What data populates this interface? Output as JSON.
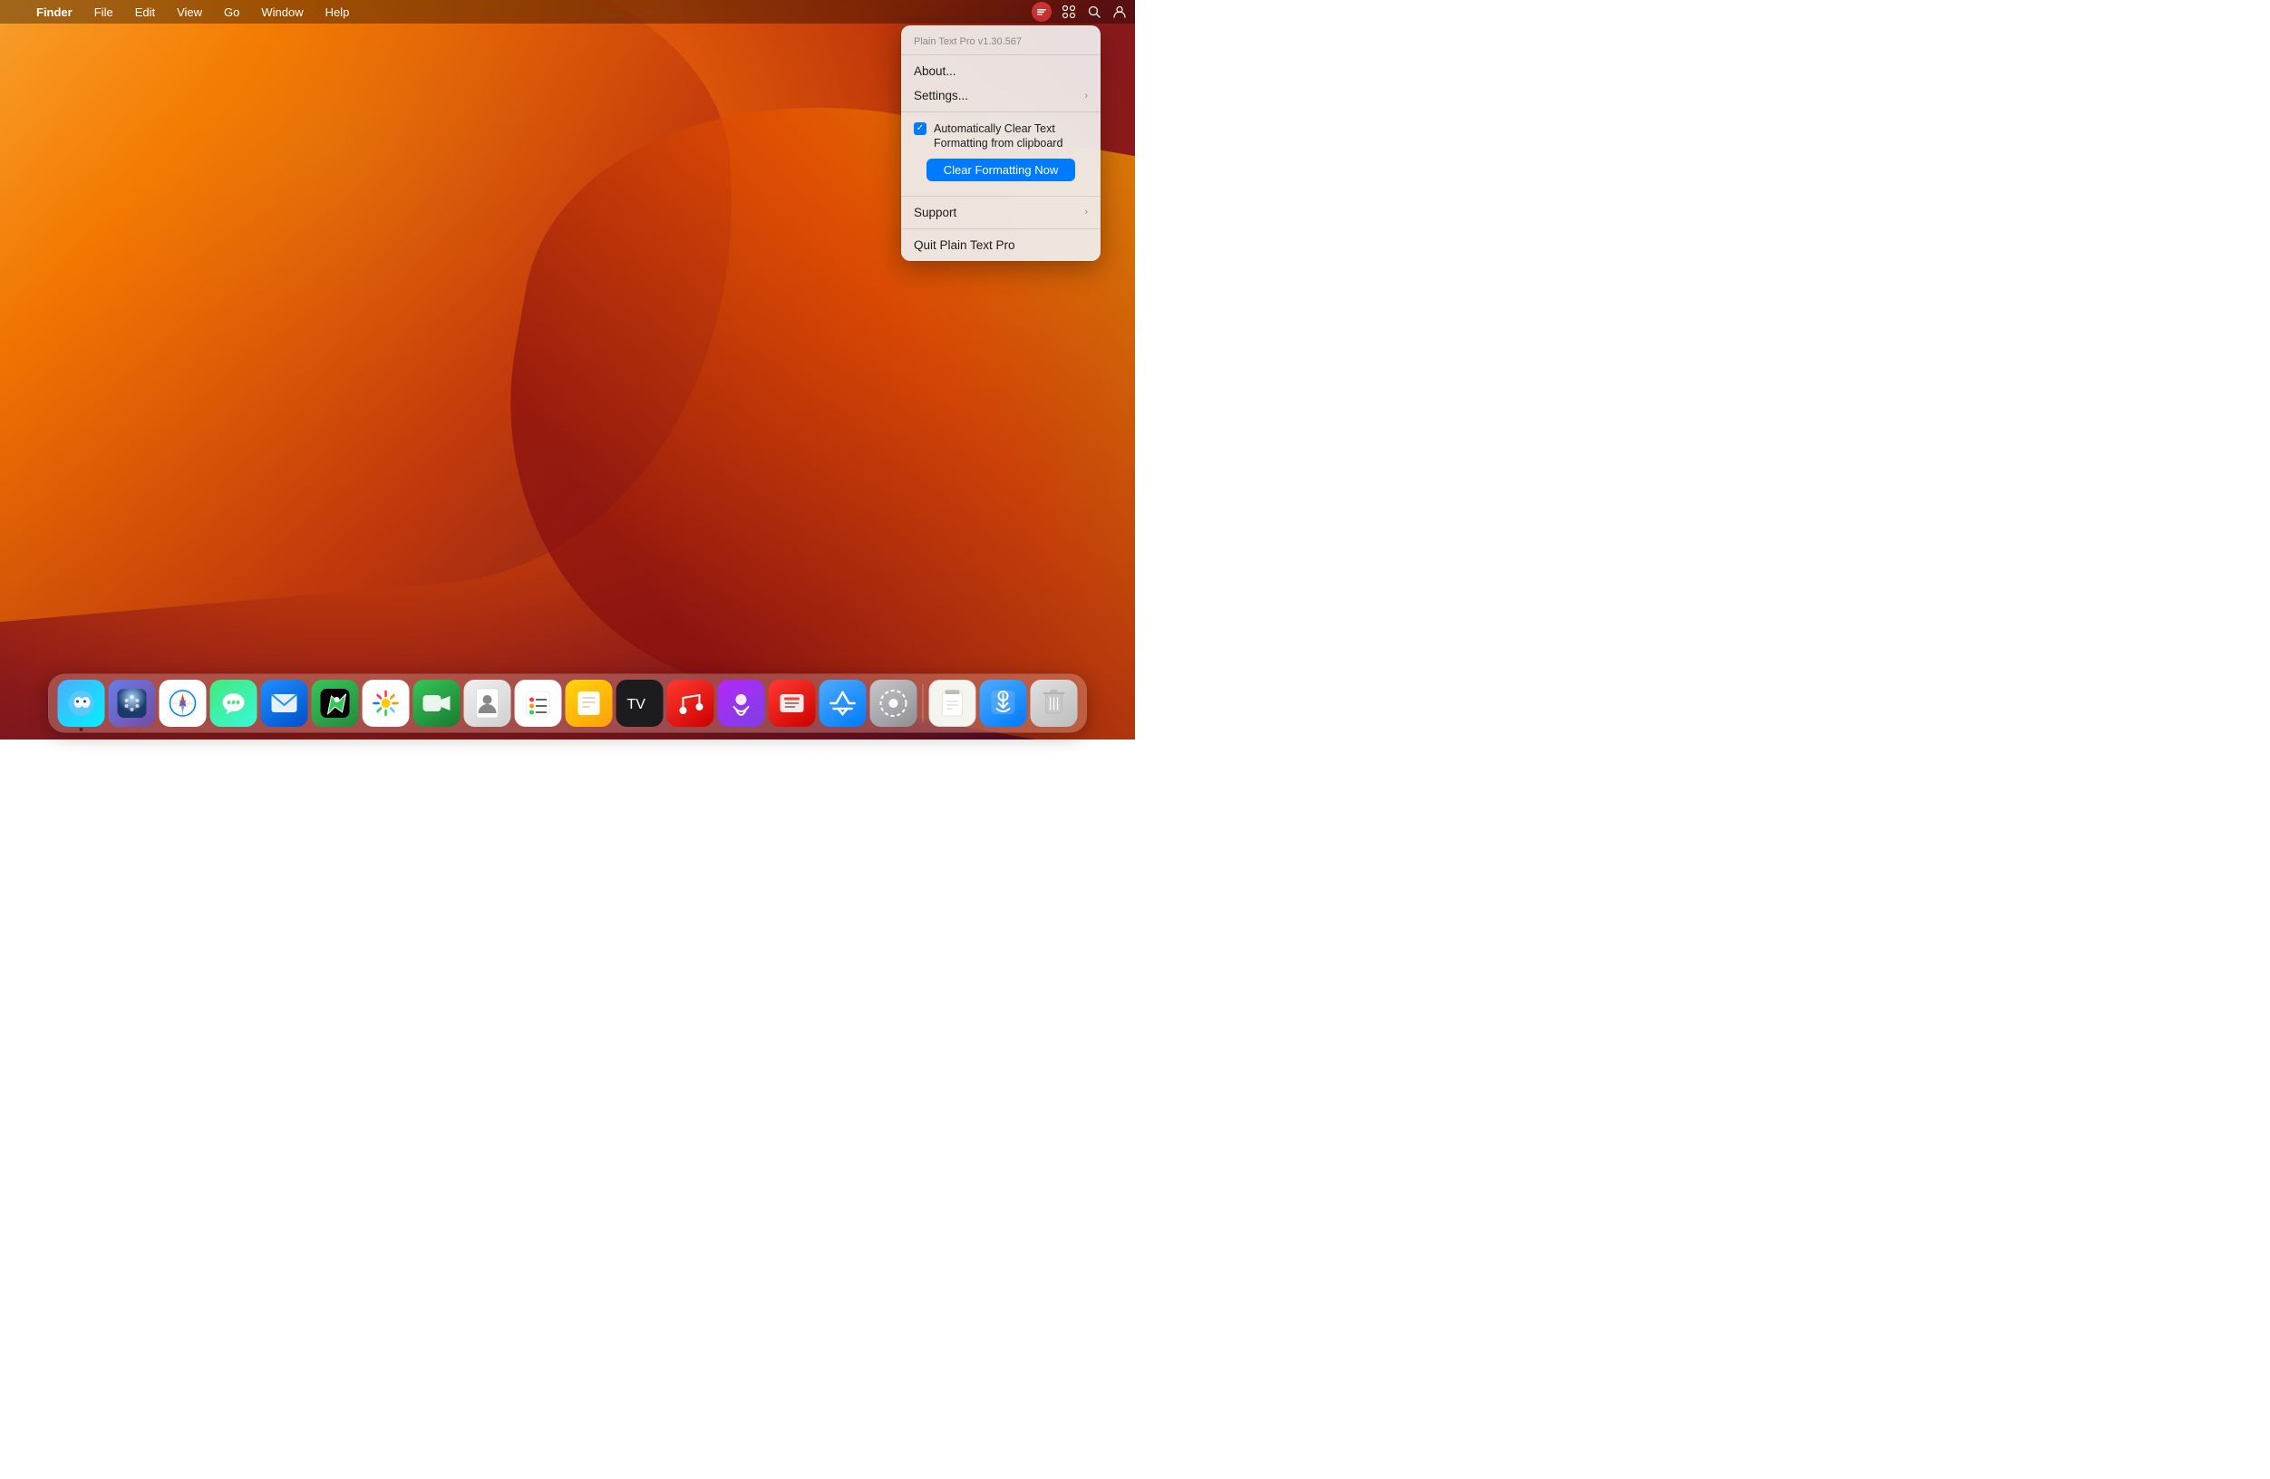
{
  "desktop": {
    "background": "macOS Ventura wallpaper"
  },
  "menubar": {
    "apple_label": "",
    "app_name": "Finder",
    "menus": [
      "File",
      "Edit",
      "View",
      "Go",
      "Window",
      "Help"
    ],
    "right_items": [
      "control-center",
      "search",
      "plaintext-icon",
      "user-icon"
    ]
  },
  "dropdown": {
    "header": "Plain Text Pro v1.30.567",
    "items": [
      {
        "id": "about",
        "label": "About...",
        "has_submenu": false
      },
      {
        "id": "settings",
        "label": "Settings...",
        "has_submenu": true
      },
      {
        "id": "checkbox",
        "label": "Automatically Clear Text Formatting from clipboard",
        "checked": true
      },
      {
        "id": "clear_now",
        "label": "Clear Formatting Now"
      },
      {
        "id": "support",
        "label": "Support",
        "has_submenu": true
      },
      {
        "id": "quit",
        "label": "Quit Plain Text Pro",
        "has_submenu": false
      }
    ]
  },
  "dock": {
    "items": [
      {
        "id": "finder",
        "emoji": "🔵",
        "label": "Finder",
        "active": true
      },
      {
        "id": "launchpad",
        "emoji": "⬛",
        "label": "Launchpad",
        "active": false
      },
      {
        "id": "safari",
        "emoji": "🧭",
        "label": "Safari",
        "active": false
      },
      {
        "id": "messages",
        "emoji": "💬",
        "label": "Messages",
        "active": false
      },
      {
        "id": "mail",
        "emoji": "✉️",
        "label": "Mail",
        "active": false
      },
      {
        "id": "maps",
        "emoji": "🗺️",
        "label": "Maps",
        "active": false
      },
      {
        "id": "photos",
        "emoji": "🌸",
        "label": "Photos",
        "active": false
      },
      {
        "id": "facetime",
        "emoji": "📹",
        "label": "FaceTime",
        "active": false
      },
      {
        "id": "contacts",
        "emoji": "👤",
        "label": "Contacts",
        "active": false
      },
      {
        "id": "reminders",
        "emoji": "📋",
        "label": "Reminders",
        "active": false
      },
      {
        "id": "notes",
        "emoji": "📝",
        "label": "Notes",
        "active": false
      },
      {
        "id": "appletv",
        "emoji": "📺",
        "label": "Apple TV",
        "active": false
      },
      {
        "id": "music",
        "emoji": "🎵",
        "label": "Music",
        "active": false
      },
      {
        "id": "podcasts",
        "emoji": "🎙️",
        "label": "Podcasts",
        "active": false
      },
      {
        "id": "news",
        "emoji": "📰",
        "label": "News",
        "active": false
      },
      {
        "id": "appstore",
        "emoji": "🅰️",
        "label": "App Store",
        "active": false
      },
      {
        "id": "systemprefs",
        "emoji": "⚙️",
        "label": "System Preferences",
        "active": false
      },
      {
        "id": "clipboard",
        "emoji": "📋",
        "label": "Clipboard Manager",
        "active": false
      },
      {
        "id": "airdrop",
        "emoji": "⬇️",
        "label": "AirDrop",
        "active": false
      },
      {
        "id": "trash",
        "emoji": "🗑️",
        "label": "Trash",
        "active": false
      }
    ]
  }
}
